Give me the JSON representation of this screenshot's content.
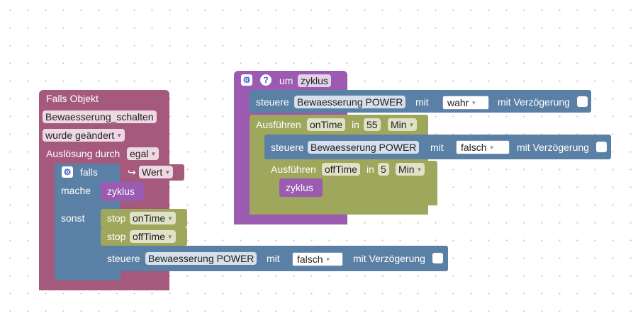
{
  "falls_objekt": {
    "title": "Falls Objekt",
    "object_name": "Bewaesserung_schalten",
    "trigger": "wurde geändert",
    "trigger_label": "Auslösung durch",
    "trigger_value": "egal"
  },
  "if_block": {
    "if_label": "falls",
    "value_arrow": "↪",
    "value_label": "Wert",
    "do_label": "mache",
    "do_call": "zyklus",
    "else_label": "sonst",
    "stop1_label": "stop",
    "stop1_var": "onTime",
    "stop2_label": "stop",
    "stop2_var": "offTime",
    "control_label": "steuere",
    "control_target": "Bewaesserung POWER",
    "control_with": "mit",
    "control_value": "falsch",
    "control_delay": "mit Verzögerung"
  },
  "function_block": {
    "um_label": "um",
    "name": "zyklus",
    "control1_label": "steuere",
    "control1_target": "Bewaesserung POWER",
    "control1_with": "mit",
    "control1_value": "wahr",
    "control1_delay": "mit Verzögerung",
    "timeout1_label": "Ausführen",
    "timeout1_var": "onTime",
    "timeout1_in": "in",
    "timeout1_amount": "55",
    "timeout1_unit": "Min",
    "control2_label": "steuere",
    "control2_target": "Bewaesserung POWER",
    "control2_with": "mit",
    "control2_value": "falsch",
    "control2_delay": "mit Verzögerung",
    "timeout2_label": "Ausführen",
    "timeout2_var": "offTime",
    "timeout2_in": "in",
    "timeout2_amount": "5",
    "timeout2_unit": "Min",
    "inner_call": "zyklus"
  },
  "colors": {
    "trigger_block": "#a5597d",
    "logic_block": "#5b80a5",
    "timer_block": "#9ea75b",
    "procedure_block": "#9a5bb0",
    "checkbox": "#ffffff"
  }
}
